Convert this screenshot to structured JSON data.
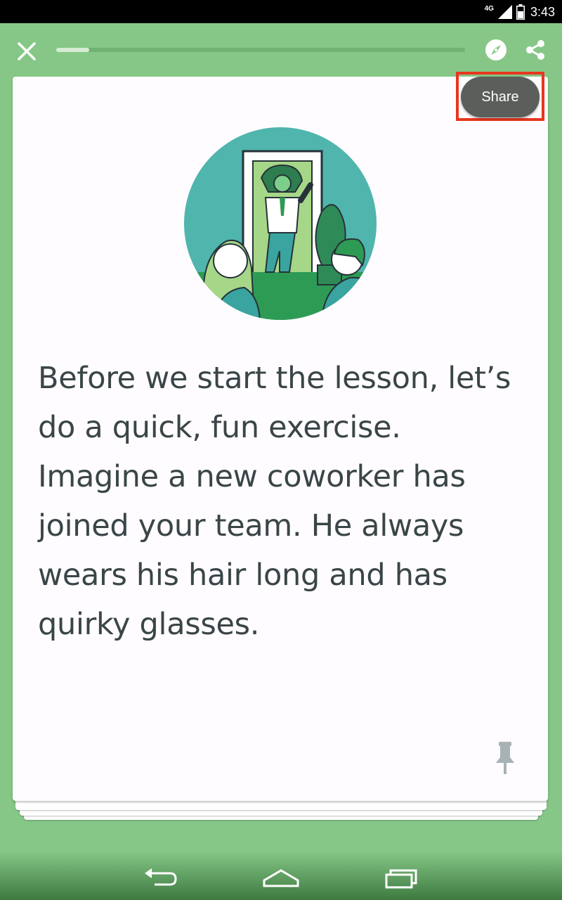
{
  "status_bar": {
    "network": "4G",
    "time": "3:43"
  },
  "toolbar": {
    "progress_fraction": 0.08
  },
  "card": {
    "share_label": "Share",
    "lesson_text": "Before we start the lesson, let’s do a quick, fun exercise. Imagine a new coworker has joined your team. He always wears his hair long and has quirky glasses."
  },
  "icons": {
    "close": "close-icon",
    "explore": "compass-icon",
    "share": "share-icon",
    "pin": "pin-icon",
    "nav_back": "back-icon",
    "nav_home": "home-icon",
    "nav_recent": "recent-apps-icon"
  },
  "colors": {
    "background": "#86c787",
    "card": "#fefcff",
    "text": "#3a4548",
    "share_button": "#5b5e5a",
    "highlight": "#e8361e"
  }
}
